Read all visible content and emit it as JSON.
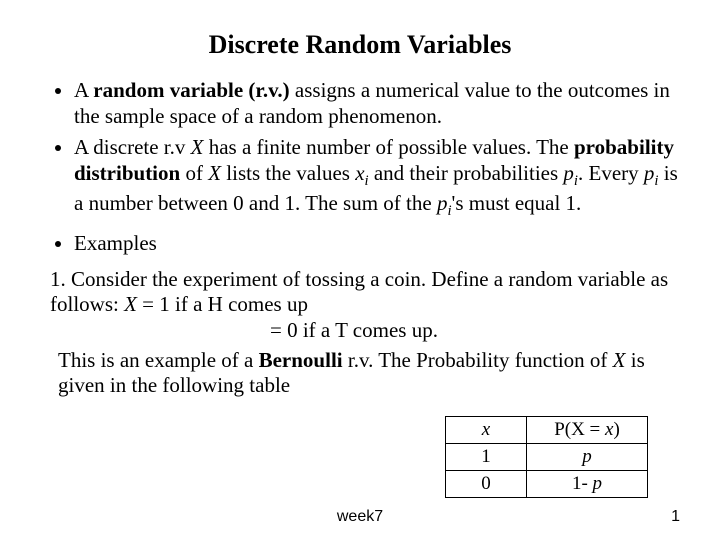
{
  "title": "Discrete Random Variables",
  "bullets": {
    "b1_a": "A ",
    "b1_b": "random variable (r.v.)",
    "b1_c": " assigns a numerical value to the outcomes in the sample space of a random phenomenon.",
    "b2_a": "A discrete r.v ",
    "b2_b": "X",
    "b2_c": " has a finite number of possible values. The ",
    "b2_d": "probability distribution",
    "b2_e": " of ",
    "b2_f": "X",
    "b2_g": " lists the values ",
    "b2_h": "x",
    "b2_i": "i",
    "b2_j": " and their probabilities ",
    "b2_k": "p",
    "b2_l": "i",
    "b2_m": ". Every ",
    "b2_n": "p",
    "b2_o": "i",
    "b2_p": " is a number between 0 and 1. The sum of the ",
    "b2_q": "p",
    "b2_r": "i",
    "b2_s": "'s must equal 1.",
    "b3": "Examples"
  },
  "example": {
    "line1_a": "1.  Consider the experiment of tossing a coin. Define a random variable as follows:  ",
    "line1_b": "X",
    "line1_c": " = 1 if a H comes up",
    "line2": "= 0 if a T comes up.",
    "line3_a": "This is an example of a ",
    "line3_b": "Bernoulli",
    "line3_c": " r.v. The Probability function of ",
    "line3_d": "X",
    "line3_e": " is given in the following table"
  },
  "table": {
    "h1": "x",
    "h2a": "P(X = ",
    "h2b": "x",
    "h2c": ")",
    "r1c1": "1",
    "r1c2": "p",
    "r2c1": "0",
    "r2c2a": "1- ",
    "r2c2b": "p"
  },
  "footer": {
    "label": "week7",
    "page": "1"
  }
}
